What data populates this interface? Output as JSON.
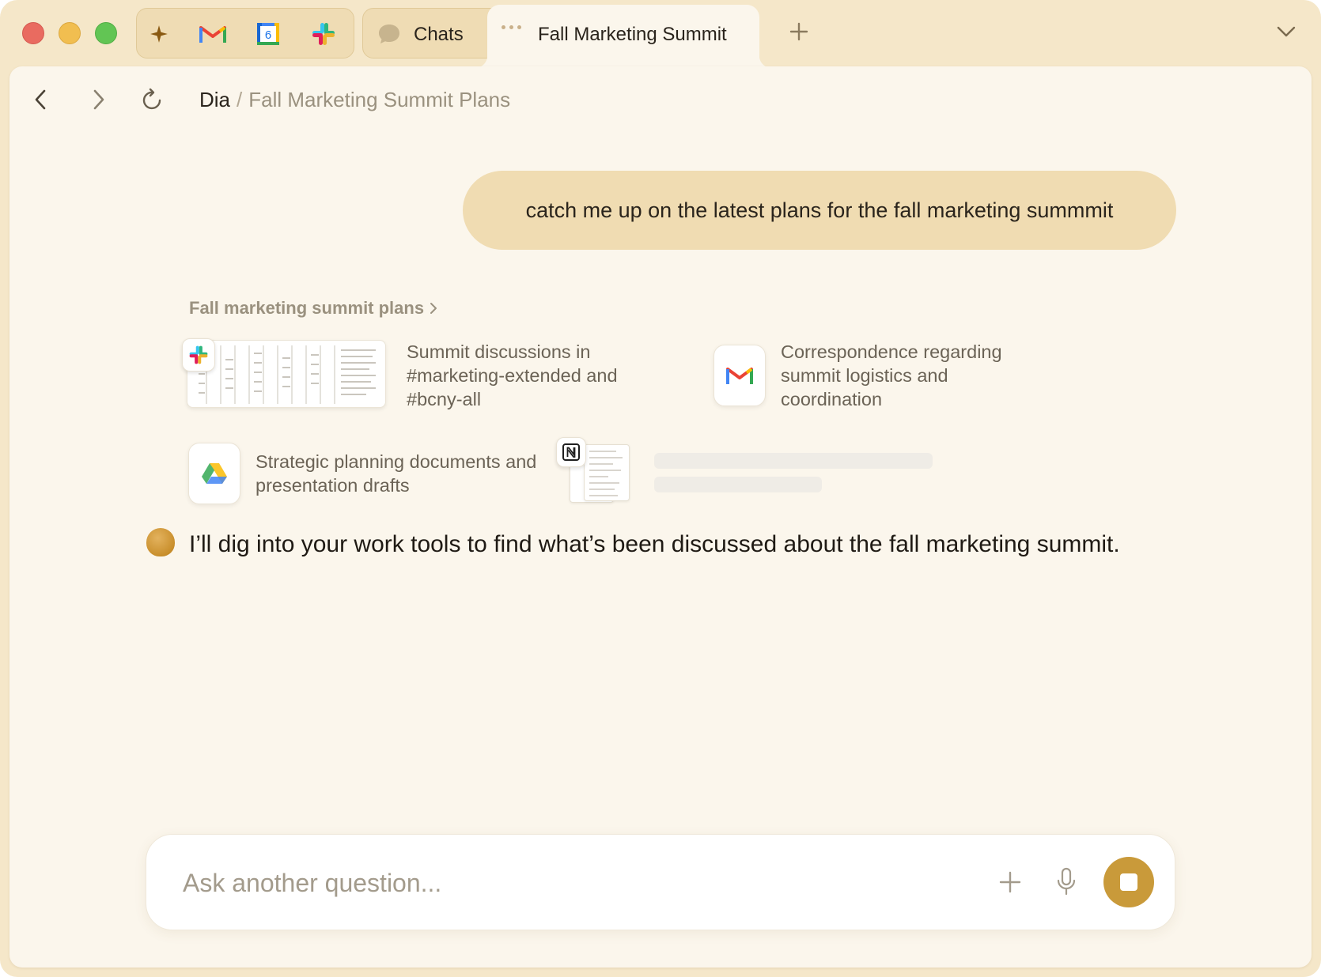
{
  "tabs": {
    "pinned": [
      {
        "icon": "sparkle-icon"
      },
      {
        "icon": "gmail-icon"
      },
      {
        "icon": "google-calendar-icon",
        "badge_text": "6"
      },
      {
        "icon": "slack-icon"
      }
    ],
    "chats_label": "Chats",
    "active_label": "Fall Marketing Summit"
  },
  "breadcrumb": {
    "root": "Dia",
    "separator": "/",
    "page": "Fall Marketing Summit Plans"
  },
  "conversation": {
    "user_message": "catch me up on the latest plans for the fall marketing summmit",
    "results": {
      "title": "Fall marketing summit plans",
      "items": [
        {
          "source_icon": "slack-icon",
          "text": "Summit discussions in #marketing-extended and #bcny-all"
        },
        {
          "source_icon": "gmail-icon",
          "text": "Correspondence regarding summit logistics and coordination"
        },
        {
          "source_icon": "google-drive-icon",
          "text": "Strategic planning documents and presentation drafts"
        },
        {
          "source_icon": "notion-icon",
          "text": ""
        }
      ]
    },
    "assistant_message": "I’ll dig into your work tools to find what’s been discussed about the fall marketing summit."
  },
  "composer": {
    "placeholder": "Ask another question..."
  },
  "colors": {
    "chrome": "#f5e7c9",
    "panel": "#fbf6ec",
    "user_bubble": "#f0dcb2",
    "stop_button": "#c99a3a"
  }
}
